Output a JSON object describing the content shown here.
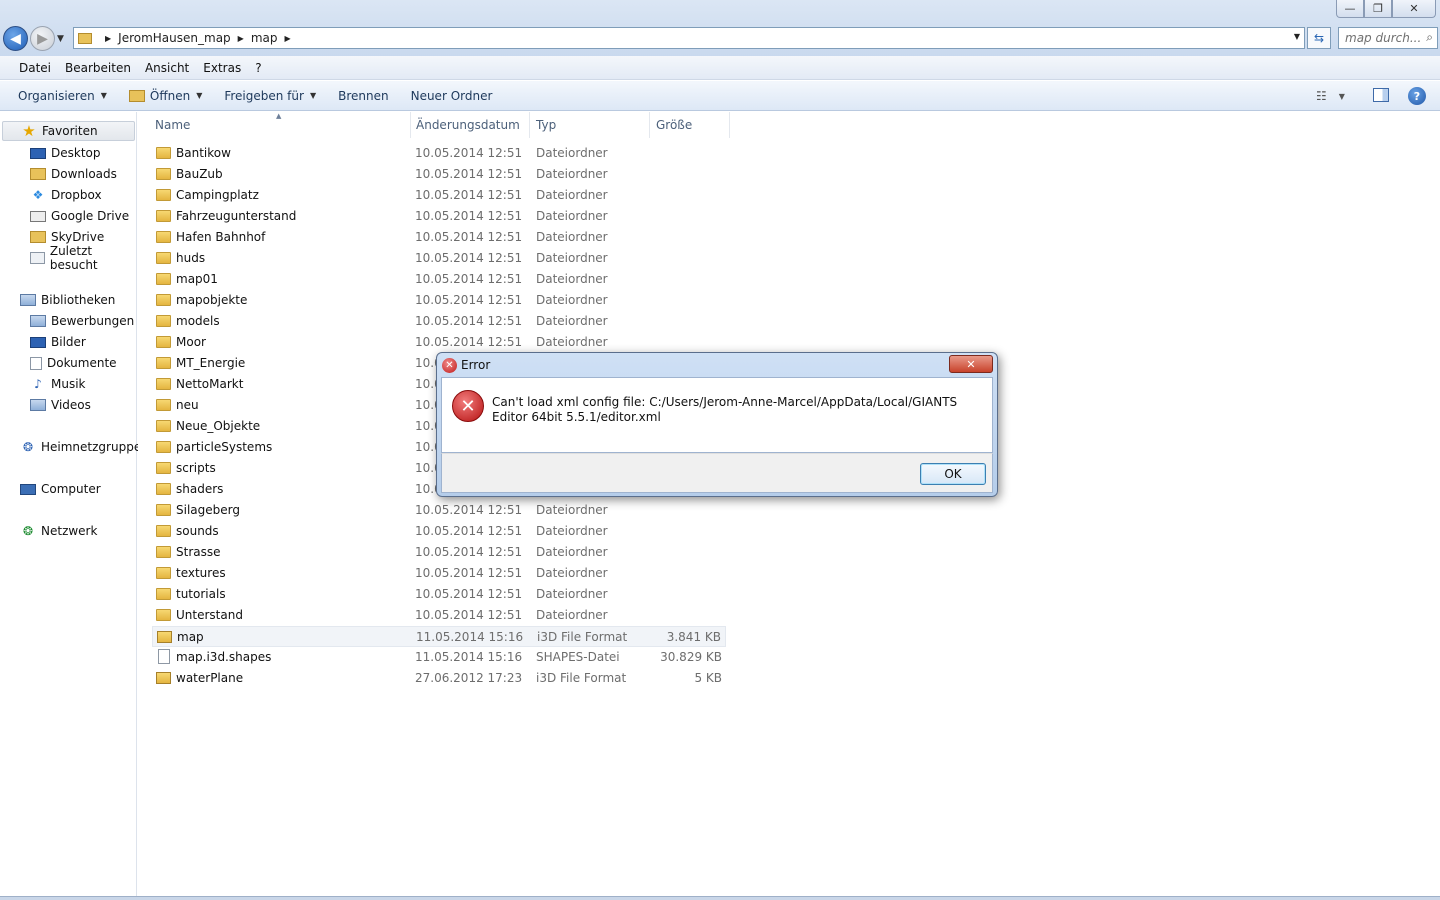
{
  "window": {
    "controls": {
      "minimize": "—",
      "maximize": "❐",
      "close": "✕"
    }
  },
  "address": {
    "crumbs": [
      "JeromHausen_map",
      "map"
    ],
    "search_placeholder": "map durch..."
  },
  "menu": [
    "Datei",
    "Bearbeiten",
    "Ansicht",
    "Extras",
    "?"
  ],
  "commands": {
    "organize": "Organisieren",
    "open": "Öffnen",
    "share": "Freigeben für",
    "burn": "Brennen",
    "new_folder": "Neuer Ordner"
  },
  "nav": {
    "favorites": "Favoriten",
    "fav_items": [
      "Desktop",
      "Downloads",
      "Dropbox",
      "Google Drive",
      "SkyDrive",
      "Zuletzt besucht"
    ],
    "libraries": "Bibliotheken",
    "lib_items": [
      "Bewerbungen",
      "Bilder",
      "Dokumente",
      "Musik",
      "Videos"
    ],
    "homegroup": "Heimnetzgruppe",
    "computer": "Computer",
    "network": "Netzwerk"
  },
  "columns": {
    "name": "Name",
    "date": "Änderungsdatum",
    "type": "Typ",
    "size": "Größe"
  },
  "files": [
    {
      "name": "Bantikow",
      "date": "10.05.2014 12:51",
      "type": "Dateiordner",
      "size": "",
      "icon": "folder-icon"
    },
    {
      "name": "BauZub",
      "date": "10.05.2014 12:51",
      "type": "Dateiordner",
      "size": "",
      "icon": "folder-icon"
    },
    {
      "name": "Campingplatz",
      "date": "10.05.2014 12:51",
      "type": "Dateiordner",
      "size": "",
      "icon": "folder-icon"
    },
    {
      "name": "Fahrzeugunterstand",
      "date": "10.05.2014 12:51",
      "type": "Dateiordner",
      "size": "",
      "icon": "folder-icon"
    },
    {
      "name": "Hafen Bahnhof",
      "date": "10.05.2014 12:51",
      "type": "Dateiordner",
      "size": "",
      "icon": "folder-icon"
    },
    {
      "name": "huds",
      "date": "10.05.2014 12:51",
      "type": "Dateiordner",
      "size": "",
      "icon": "folder-icon"
    },
    {
      "name": "map01",
      "date": "10.05.2014 12:51",
      "type": "Dateiordner",
      "size": "",
      "icon": "folder-icon"
    },
    {
      "name": "mapobjekte",
      "date": "10.05.2014 12:51",
      "type": "Dateiordner",
      "size": "",
      "icon": "folder-icon"
    },
    {
      "name": "models",
      "date": "10.05.2014 12:51",
      "type": "Dateiordner",
      "size": "",
      "icon": "folder-icon"
    },
    {
      "name": "Moor",
      "date": "10.05.2014 12:51",
      "type": "Dateiordner",
      "size": "",
      "icon": "folder-icon"
    },
    {
      "name": "MT_Energie",
      "date": "10.0",
      "type": "",
      "size": "",
      "icon": "folder-icon"
    },
    {
      "name": "NettoMarkt",
      "date": "10.0",
      "type": "",
      "size": "",
      "icon": "folder-icon"
    },
    {
      "name": "neu",
      "date": "10.0",
      "type": "",
      "size": "",
      "icon": "folder-icon"
    },
    {
      "name": "Neue_Objekte",
      "date": "10.0",
      "type": "",
      "size": "",
      "icon": "folder-icon"
    },
    {
      "name": "particleSystems",
      "date": "10.0",
      "type": "",
      "size": "",
      "icon": "folder-icon"
    },
    {
      "name": "scripts",
      "date": "10.0",
      "type": "",
      "size": "",
      "icon": "folder-icon"
    },
    {
      "name": "shaders",
      "date": "10.0",
      "type": "",
      "size": "",
      "icon": "folder-icon"
    },
    {
      "name": "Silageberg",
      "date": "10.05.2014 12:51",
      "type": "Dateiordner",
      "size": "",
      "icon": "folder-icon"
    },
    {
      "name": "sounds",
      "date": "10.05.2014 12:51",
      "type": "Dateiordner",
      "size": "",
      "icon": "folder-icon"
    },
    {
      "name": "Strasse",
      "date": "10.05.2014 12:51",
      "type": "Dateiordner",
      "size": "",
      "icon": "folder-icon"
    },
    {
      "name": "textures",
      "date": "10.05.2014 12:51",
      "type": "Dateiordner",
      "size": "",
      "icon": "folder-icon"
    },
    {
      "name": "tutorials",
      "date": "10.05.2014 12:51",
      "type": "Dateiordner",
      "size": "",
      "icon": "folder-icon"
    },
    {
      "name": "Unterstand",
      "date": "10.05.2014 12:51",
      "type": "Dateiordner",
      "size": "",
      "icon": "folder-icon"
    },
    {
      "name": "map",
      "date": "11.05.2014 15:16",
      "type": "i3D File Format",
      "size": "3.841 KB",
      "icon": "i3d-file-icon",
      "highlight": true
    },
    {
      "name": "map.i3d.shapes",
      "date": "11.05.2014 15:16",
      "type": "SHAPES-Datei",
      "size": "30.829 KB",
      "icon": "blank-file-icon"
    },
    {
      "name": "waterPlane",
      "date": "27.06.2012 17:23",
      "type": "i3D File Format",
      "size": "5 KB",
      "icon": "i3d-file-icon"
    }
  ],
  "dialog": {
    "title": "Error",
    "message": "Can't load xml config file: C:/Users/Jerom-Anne-Marcel/AppData/Local/GIANTS Editor 64bit 5.5.1/editor.xml",
    "ok": "OK",
    "close": "✕"
  }
}
